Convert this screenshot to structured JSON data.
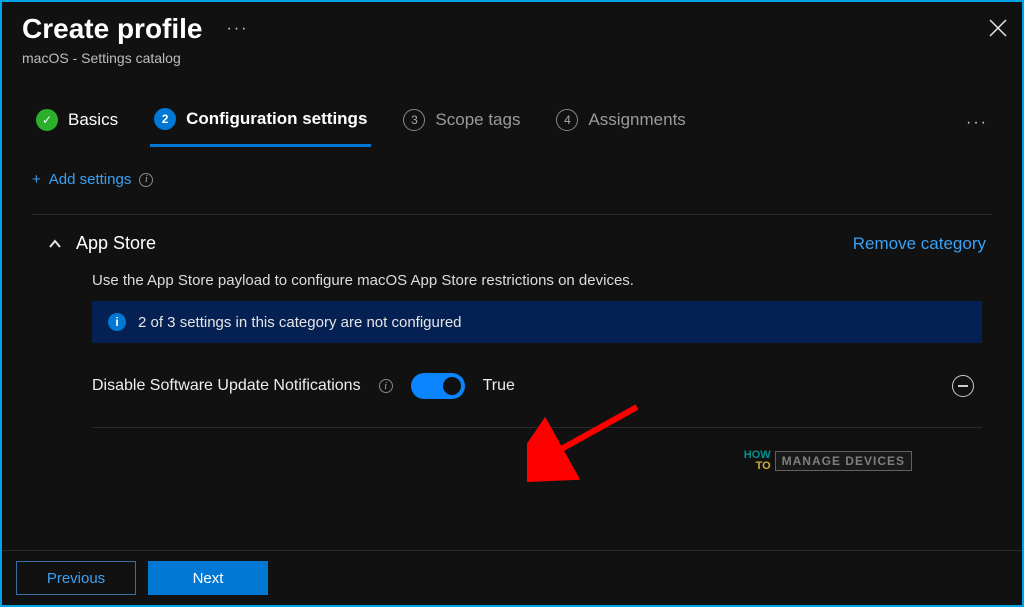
{
  "header": {
    "title": "Create profile",
    "subtitle": "macOS - Settings catalog"
  },
  "tabs": [
    {
      "label": "Basics",
      "state": "done",
      "step": "✓"
    },
    {
      "label": "Configuration settings",
      "state": "active",
      "step": "2"
    },
    {
      "label": "Scope tags",
      "state": "upcoming",
      "step": "3"
    },
    {
      "label": "Assignments",
      "state": "upcoming",
      "step": "4"
    }
  ],
  "actions": {
    "add_settings": "Add settings"
  },
  "category": {
    "name": "App Store",
    "remove_label": "Remove category",
    "description": "Use the App Store payload to configure macOS App Store restrictions on devices.",
    "banner": "2 of 3 settings in this category are not configured",
    "settings": [
      {
        "label": "Disable Software Update Notifications",
        "value_label": "True",
        "value": true
      }
    ]
  },
  "footer": {
    "previous": "Previous",
    "next": "Next"
  },
  "watermark": {
    "how": "HOW",
    "to": "TO",
    "brand": "MANAGE DEVICES"
  }
}
